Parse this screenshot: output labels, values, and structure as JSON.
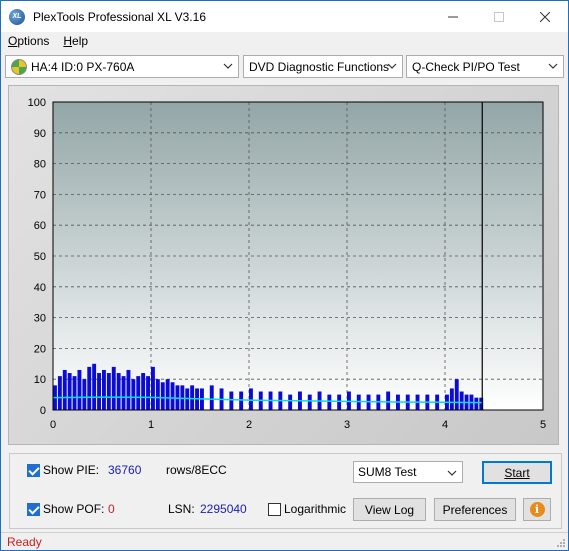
{
  "window": {
    "title": "PlexTools Professional XL V3.16",
    "icon_label": "XL",
    "minimize_icon": "minimize-icon",
    "maximize_icon": "maximize-icon",
    "close_icon": "close-icon"
  },
  "menu": {
    "items": [
      {
        "label": "Options",
        "accel": "O",
        "rest": "ptions"
      },
      {
        "label": "Help",
        "accel": "H",
        "rest": "elp"
      }
    ]
  },
  "toolbar": {
    "drive": "HA:4 ID:0  PX-760A",
    "function": "DVD Diagnostic Functions",
    "test": "Q-Check PI/PO Test"
  },
  "chart_data": {
    "type": "bar",
    "title": "",
    "xlabel": "",
    "ylabel": "",
    "xlim": [
      0,
      5
    ],
    "ylim": [
      0,
      100
    ],
    "x_ticks": [
      "0",
      "1",
      "2",
      "3",
      "4",
      "5"
    ],
    "y_ticks": [
      "0",
      "10",
      "20",
      "30",
      "40",
      "50",
      "60",
      "70",
      "80",
      "90",
      "100"
    ],
    "grid": true,
    "scan_end_x": 4.38,
    "colors": {
      "plot_top": "#93a6a7",
      "plot_bottom": "#ffffff",
      "pie_bars": "#0b0bd6",
      "pie_line": "#00e0e0",
      "end_marker": "#000000"
    },
    "series": [
      {
        "name": "PIE",
        "x": [
          0.0,
          0.05,
          0.1,
          0.15,
          0.2,
          0.25,
          0.3,
          0.35,
          0.4,
          0.45,
          0.5,
          0.55,
          0.6,
          0.65,
          0.7,
          0.75,
          0.8,
          0.85,
          0.9,
          0.95,
          1.0,
          1.05,
          1.1,
          1.15,
          1.2,
          1.25,
          1.3,
          1.35,
          1.4,
          1.45,
          1.5,
          1.6,
          1.7,
          1.8,
          1.9,
          2.0,
          2.1,
          2.2,
          2.3,
          2.4,
          2.5,
          2.6,
          2.7,
          2.8,
          2.9,
          3.0,
          3.1,
          3.2,
          3.3,
          3.4,
          3.5,
          3.6,
          3.7,
          3.8,
          3.9,
          4.0,
          4.05,
          4.1,
          4.15,
          4.2,
          4.25,
          4.3,
          4.35
        ],
        "values": [
          8,
          11,
          13,
          12,
          11,
          13,
          10,
          14,
          15,
          12,
          13,
          12,
          14,
          12,
          11,
          13,
          10,
          11,
          12,
          11,
          14,
          10,
          9,
          10,
          9,
          8,
          8,
          7,
          8,
          7,
          7,
          8,
          7,
          6,
          6,
          7,
          6,
          6,
          6,
          5,
          6,
          5,
          6,
          5,
          5,
          6,
          5,
          5,
          5,
          6,
          5,
          5,
          5,
          5,
          5,
          5,
          7,
          10,
          6,
          5,
          5,
          4,
          4
        ]
      },
      {
        "name": "PIE average",
        "x": [
          0.0,
          0.5,
          1.0,
          1.5,
          2.0,
          2.5,
          3.0,
          3.5,
          4.0,
          4.38
        ],
        "values": [
          4.0,
          4.2,
          4.1,
          3.6,
          3.2,
          3.0,
          2.8,
          2.6,
          2.5,
          2.4
        ]
      }
    ]
  },
  "controls": {
    "show_pie_label": "Show PIE:",
    "pie_count": "36760",
    "pie_unit": "rows/8ECC",
    "show_pof_label": "Show POF:",
    "pof_count": "0",
    "lsn_label": "LSN:",
    "lsn_value": "2295040",
    "logarithmic_label": "Logarithmic",
    "test_select": "SUM8 Test",
    "start_label": "Start",
    "view_log_label": "View Log",
    "preferences_label": "Preferences",
    "show_pie_checked": true,
    "show_pof_checked": true,
    "logarithmic_checked": false
  },
  "status": {
    "text": "Ready"
  }
}
